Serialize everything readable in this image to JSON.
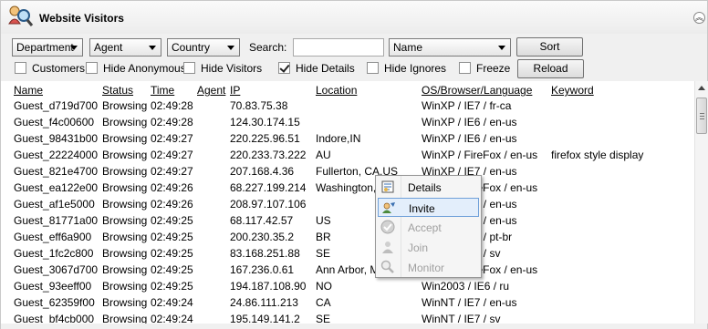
{
  "window": {
    "title": "Website Visitors"
  },
  "toolbar": {
    "department": "Department",
    "agent": "Agent",
    "country": "Country",
    "search_label": "Search:",
    "search_value": "",
    "sort_field": "Name",
    "sort_button": "Sort",
    "reload_button": "Reload",
    "checkboxes": [
      {
        "label": "Customers",
        "checked": false
      },
      {
        "label": "Hide Anonymous",
        "checked": false
      },
      {
        "label": "Hide Visitors",
        "checked": false
      },
      {
        "label": "Hide Details",
        "checked": true
      },
      {
        "label": "Hide Ignores",
        "checked": false
      },
      {
        "label": "Freeze",
        "checked": false
      }
    ]
  },
  "table": {
    "columns": [
      "Name",
      "Status",
      "Time",
      "Agent",
      "IP",
      "Location",
      "OS/Browser/Language",
      "Keyword"
    ],
    "rows": [
      [
        "Guest_d719d700",
        "Browsing",
        "02:49:28",
        "",
        "70.83.75.38",
        "",
        "WinXP / IE7 / fr-ca",
        ""
      ],
      [
        "Guest_f4c00600",
        "Browsing",
        "02:49:28",
        "",
        "124.30.174.15",
        "",
        "WinXP / IE6 / en-us",
        ""
      ],
      [
        "Guest_98431b00",
        "Browsing",
        "02:49:27",
        "",
        "220.225.96.51",
        "Indore,IN",
        "WinXP / IE6 / en-us",
        ""
      ],
      [
        "Guest_22224000",
        "Browsing",
        "02:49:27",
        "",
        "220.233.73.222",
        "AU",
        "WinXP / FireFox / en-us",
        "firefox style display"
      ],
      [
        "Guest_821e4700",
        "Browsing",
        "02:49:27",
        "",
        "207.168.4.36",
        "Fullerton, CA,US",
        "WinXP / IE7 / en-us",
        ""
      ],
      [
        "Guest_ea122e00",
        "Browsing",
        "02:49:26",
        "",
        "68.227.199.214",
        "Washington, DC,US",
        "WinXP / FireFox / en-us",
        ""
      ],
      [
        "Guest_af1e5000",
        "Browsing",
        "02:49:26",
        "",
        "208.97.107.106",
        "",
        "WinXP / IE7 / en-us",
        ""
      ],
      [
        "Guest_81771a00",
        "Browsing",
        "02:49:25",
        "",
        "68.117.42.57",
        "US",
        "WinXP / IE7 / en-us",
        ""
      ],
      [
        "Guest_eff6a900",
        "Browsing",
        "02:49:25",
        "",
        "200.230.35.2",
        "BR",
        "WinXP / IE7 / pt-br",
        ""
      ],
      [
        "Guest_1fc2c800",
        "Browsing",
        "02:49:25",
        "",
        "83.168.251.88",
        "SE",
        "WinXP / IE7 / sv",
        ""
      ],
      [
        "Guest_3067d700",
        "Browsing",
        "02:49:25",
        "",
        "167.236.0.61",
        "Ann Arbor, MI,US",
        "WinXP / FireFox / en-us",
        ""
      ],
      [
        "Guest_93eeff00",
        "Browsing",
        "02:49:25",
        "",
        "194.187.108.90",
        "NO",
        "Win2003 / IE6 / ru",
        ""
      ],
      [
        "Guest_62359f00",
        "Browsing",
        "02:49:24",
        "",
        "24.86.111.213",
        "CA",
        "WinNT / IE7 / en-us",
        ""
      ],
      [
        "Guest_bf4cb000",
        "Browsing",
        "02:49:24",
        "",
        "195.149.141.2",
        "SE",
        "WinNT / IE7 / sv",
        ""
      ]
    ]
  },
  "context_menu": {
    "items": [
      {
        "label": "Details",
        "icon": "details-icon",
        "enabled": true,
        "highlighted": false
      },
      {
        "label": "Invite",
        "icon": "invite-icon",
        "enabled": true,
        "highlighted": true
      },
      {
        "label": "Accept",
        "icon": "accept-icon",
        "enabled": false,
        "highlighted": false
      },
      {
        "label": "Join",
        "icon": "join-icon",
        "enabled": false,
        "highlighted": false
      },
      {
        "label": "Monitor",
        "icon": "monitor-icon",
        "enabled": false,
        "highlighted": false
      }
    ]
  },
  "colors": {
    "highlight_border": "#6fa0d9",
    "highlight_fill": "#e3eefb",
    "header_bg": "#f0f0f0"
  }
}
